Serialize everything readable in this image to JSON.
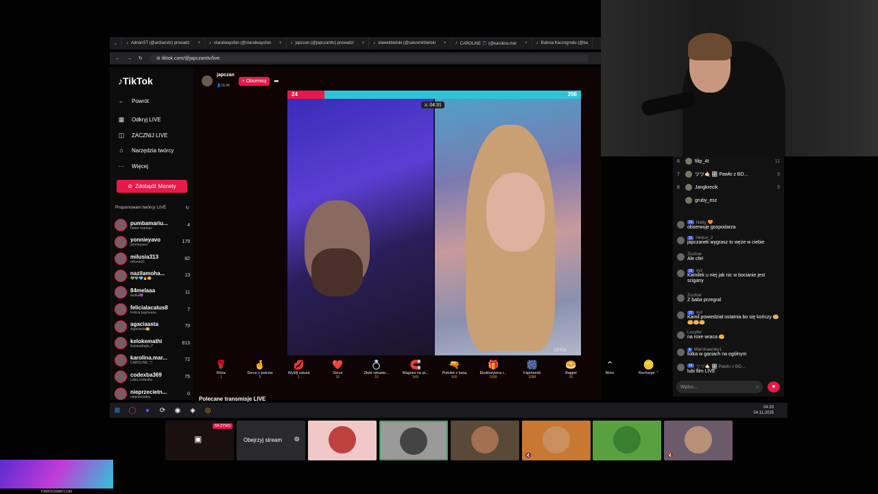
{
  "browser": {
    "tabs": [
      "AdrianST (@ardianstx) prowadz",
      "staralwaysfan (@staralwaysfan",
      "japczan (@japczanttv) prowadzi",
      "slawekbielski (@sawomirbielski",
      "CAROLINE 🎵 (@karolina.mar",
      "Babcia Kaczogrodu (@ba"
    ],
    "url": "tiktok.com/@japczanttv/live"
  },
  "sidebar": {
    "logo": "TikTok",
    "nav": [
      {
        "icon": "←",
        "label": "Powrót"
      },
      {
        "icon": "▦",
        "label": "Odkryj LIVE"
      },
      {
        "icon": "◫",
        "label": "ZACZNIJ LIVE"
      },
      {
        "icon": "⌂",
        "label": "Narzędzia twórcy"
      },
      {
        "icon": "···",
        "label": "Więcej"
      }
    ],
    "coins_button": "Zdobądź Monety",
    "suggested_header": "Proponowani twórcy LIVE",
    "creators": [
      {
        "name": "pumbamariu...",
        "sub": "bober mariusz",
        "count": "4"
      },
      {
        "name": "yonnieyavo",
        "sub": "yonnieyavo",
        "count": "179"
      },
      {
        "name": "milusia313",
        "sub": "milusia31",
        "count": "82"
      },
      {
        "name": "nazilamoha...",
        "sub": "💚🩶🩵🔥🥯",
        "count": "13"
      },
      {
        "name": "84melaaa",
        "sub": "melka💜",
        "count": "11"
      },
      {
        "name": "felicialacatus8",
        "sub": "Felicia popneasa",
        "count": "7"
      },
      {
        "name": "agaciaasta",
        "sub": "Agaciasta🥯",
        "count": "79"
      },
      {
        "name": "kelokemathi",
        "sub": "KelokeMathi🖊",
        "count": "813"
      },
      {
        "name": "karolina.mar...",
        "sub": "CAROLINE 🎵",
        "count": "72"
      },
      {
        "name": "codexba369",
        "sub": "Luba codexBa",
        "count": "75"
      },
      {
        "name": "nieprzecietn...",
        "sub": "nieprzecietny",
        "count": "0"
      }
    ]
  },
  "stream": {
    "host": "japczan",
    "viewers": "18.4K",
    "follow": "+ Obserwuj",
    "score_left": "24",
    "score_right": "206",
    "timer": "04:31",
    "watermark": "LEYDI"
  },
  "gifts": [
    {
      "icon": "🌹",
      "name": "Róża",
      "price": "1"
    },
    {
      "icon": "🤞",
      "name": "Serce z palców",
      "price": "5"
    },
    {
      "icon": "💋",
      "name": "Wyślij całusa",
      "price": "1"
    },
    {
      "icon": "❤️",
      "name": "Serce",
      "price": "10"
    },
    {
      "icon": "💍",
      "name": "Złote rękawic...",
      "price": "10"
    },
    {
      "icon": "🧲",
      "name": "Magnes na pi...",
      "price": "549"
    },
    {
      "icon": "🔫",
      "name": "Pistolet z kasą",
      "price": "500"
    },
    {
      "icon": "🎁",
      "name": "Ekskluzywna i...",
      "price": "1099"
    },
    {
      "icon": "🎆",
      "name": "Fajerwerki",
      "price": "1088"
    },
    {
      "icon": "🥯",
      "name": "Bajgiel",
      "price": "35"
    },
    {
      "icon": "⌃",
      "name": "More",
      "price": ""
    },
    {
      "icon": "🪙",
      "name": "Recharge ⌃",
      "price": ""
    }
  ],
  "section_title": "Polecane transmisje LIVE",
  "ranking": [
    {
      "n": "6",
      "name": "filip_4t",
      "c": "11"
    },
    {
      "n": "7",
      "name": "ツツ🤙🏻 🎛️ Pawło z BD...",
      "c": "9"
    },
    {
      "n": "8",
      "name": "Jangkrecik",
      "c": "9"
    },
    {
      "n": "",
      "name": "gruby_esz",
      "c": ""
    }
  ],
  "chat": [
    {
      "user": "Natty 🧡",
      "badge": "22",
      "text": "obserwuje gospodarza"
    },
    {
      "user": "nequu_2",
      "badge": "11",
      "text": "japczanek wygrasz to węże w ciebie"
    },
    {
      "user": "Zuchwi",
      "badge": "",
      "text": "Ale cfel"
    },
    {
      "user": "xyz",
      "badge": "22",
      "text": "Kamilek u niej jak nic w bocianie jest scigany"
    },
    {
      "user": "Zuchwi",
      "badge": "",
      "text": "Z baba przegral"
    },
    {
      "user": "xyz",
      "badge": "22",
      "text": "Kamil powiedział ostatnia bo się kończy 🥯🥯🥯🥯"
    },
    {
      "user": "Lucyfer",
      "badge": "",
      "text": "na roxe wraca 🥯"
    },
    {
      "user": "Warshawsky1",
      "badge": "4",
      "text": "fotka w gaciach na ogólnym"
    },
    {
      "user": "ツツ🤙🏻 🎛️ Pawło z BD...",
      "badge": "16",
      "text": "lubi film LIVE"
    }
  ],
  "chat_placeholder": "Wpisz...",
  "taskbar": {
    "time": "04:33",
    "date": "04.11.2025"
  },
  "discord": {
    "live_badge": "NA ŻYWO",
    "watch_button": "Obejrzyj stream"
  },
  "corner_caption": "PIRATESWAP.COM",
  "colors": {
    "accent": "#e8194a",
    "pk_right": "#2ec4d8"
  }
}
